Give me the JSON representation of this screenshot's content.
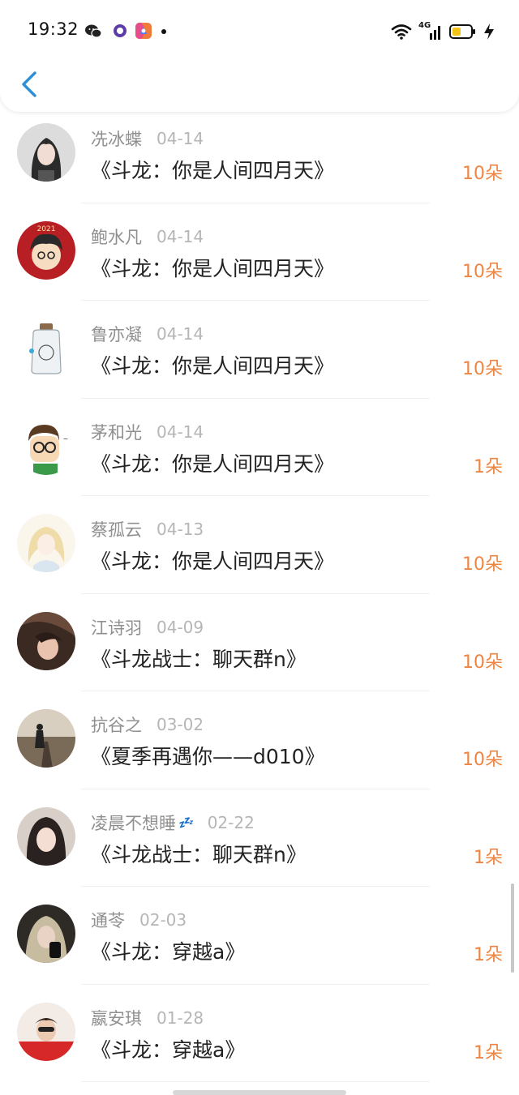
{
  "status_bar": {
    "time": "19:32",
    "network": "4G",
    "left_icons": [
      "wechat-icon",
      "circle-app-icon",
      "colorful-app-icon",
      "dot-icon"
    ],
    "right_icons": [
      "wifi-icon",
      "signal-icon",
      "battery-icon",
      "charging-bolt-icon"
    ]
  },
  "header": {
    "back_icon": "chevron-left-icon",
    "accent_color": "#2e8fd8"
  },
  "colors": {
    "name": "#8f8f8f",
    "date": "#b6b6b6",
    "title": "#222222",
    "count": "#ef8542"
  },
  "items": [
    {
      "name": "冼冰蝶",
      "date": "04-14",
      "title": "《斗龙：你是人间四月天》",
      "count": "10朵"
    },
    {
      "name": "鲍水凡",
      "date": "04-14",
      "title": "《斗龙：你是人间四月天》",
      "count": "10朵"
    },
    {
      "name": "鲁亦凝",
      "date": "04-14",
      "title": "《斗龙：你是人间四月天》",
      "count": "10朵"
    },
    {
      "name": "茅和光",
      "date": "04-14",
      "title": "《斗龙：你是人间四月天》",
      "count": "1朵"
    },
    {
      "name": "蔡孤云",
      "date": "04-13",
      "title": "《斗龙：你是人间四月天》",
      "count": "10朵"
    },
    {
      "name": "江诗羽",
      "date": "04-09",
      "title": "《斗龙战士：聊天群n》",
      "count": "10朵"
    },
    {
      "name": "抗谷之",
      "date": "03-02",
      "title": "《夏季再遇你——d010》",
      "count": "10朵"
    },
    {
      "name": "凌晨不想睡",
      "name_suffix": "💤",
      "date": "02-22",
      "title": "《斗龙战士：聊天群n》",
      "count": "1朵"
    },
    {
      "name": "通苓",
      "date": "02-03",
      "title": "《斗龙：穿越a》",
      "count": "1朵"
    },
    {
      "name": "嬴安琪",
      "date": "01-28",
      "title": "《斗龙：穿越a》",
      "count": "1朵"
    }
  ]
}
